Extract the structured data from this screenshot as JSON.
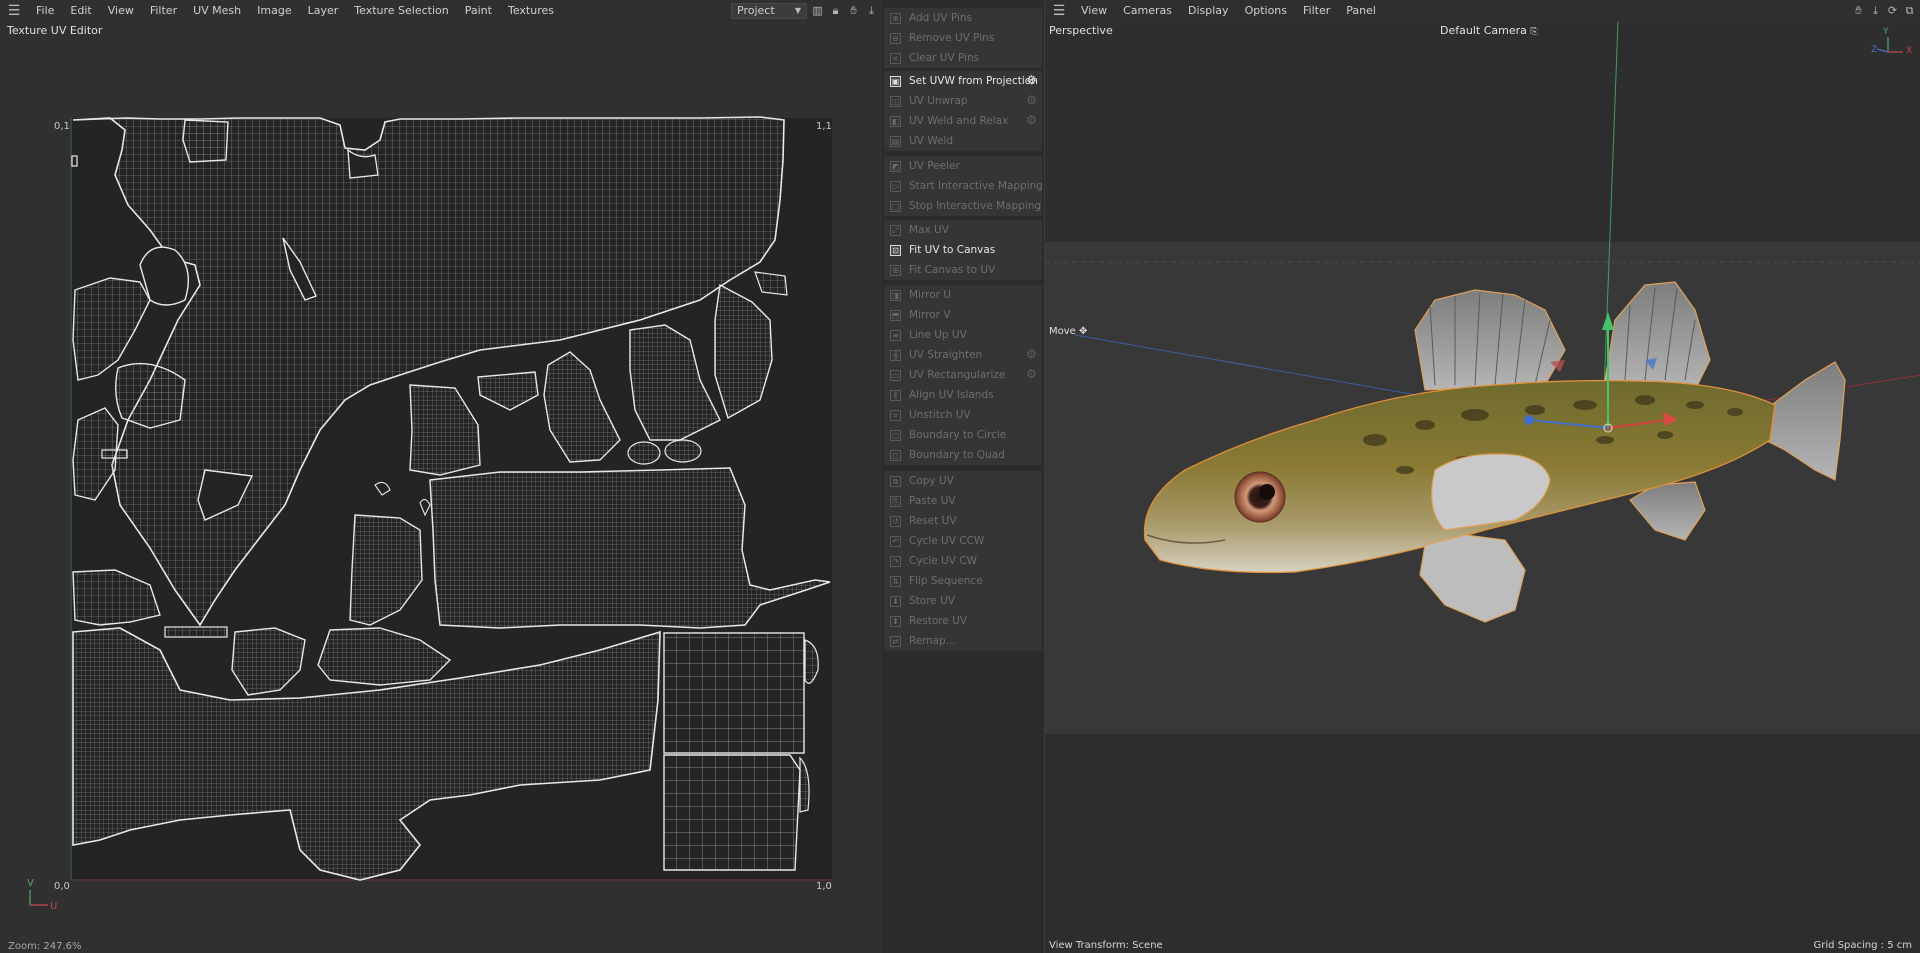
{
  "uv_editor": {
    "menu": [
      "File",
      "Edit",
      "View",
      "Filter",
      "UV Mesh",
      "Image",
      "Layer",
      "Texture Selection",
      "Paint",
      "Textures"
    ],
    "project_select": "Project",
    "title": "Texture UV Editor",
    "corners": {
      "top_left": "0,1",
      "top_right": "1,1",
      "bottom_left": "0,0",
      "bottom_right": "1,0"
    },
    "axes": {
      "v": "V",
      "u": "U"
    },
    "zoom": "Zoom: 247.6%"
  },
  "commands": {
    "group1": [
      {
        "label": "Add UV Pins",
        "enabled": false,
        "gear": false,
        "icon": "pin-icon"
      },
      {
        "label": "Remove UV Pins",
        "enabled": false,
        "gear": false,
        "icon": "pin-remove-icon"
      },
      {
        "label": "Clear UV Pins",
        "enabled": false,
        "gear": false,
        "icon": "clear-icon"
      }
    ],
    "group2": [
      {
        "label": "Set UVW from Projection",
        "enabled": true,
        "gear": true,
        "icon": "projection-icon"
      },
      {
        "label": "UV Unwrap",
        "enabled": false,
        "gear": true,
        "icon": "unwrap-icon"
      },
      {
        "label": "UV Weld and Relax",
        "enabled": false,
        "gear": true,
        "icon": "weld-relax-icon"
      },
      {
        "label": "UV Weld",
        "enabled": false,
        "gear": false,
        "icon": "weld-icon"
      }
    ],
    "group3": [
      {
        "label": "UV Peeler",
        "enabled": false,
        "gear": false,
        "icon": "peeler-icon"
      },
      {
        "label": "Start Interactive Mapping",
        "enabled": false,
        "gear": false,
        "icon": "play-icon"
      },
      {
        "label": "Stop Interactive Mapping",
        "enabled": false,
        "gear": false,
        "icon": "stop-icon"
      }
    ],
    "group4": [
      {
        "label": "Max UV",
        "enabled": false,
        "gear": false,
        "icon": "max-icon"
      },
      {
        "label": "Fit UV to Canvas",
        "enabled": true,
        "gear": false,
        "icon": "fit-canvas-icon"
      },
      {
        "label": "Fit Canvas to UV",
        "enabled": false,
        "gear": false,
        "icon": "fit-uv-icon"
      }
    ],
    "group5": [
      {
        "label": "Mirror U",
        "enabled": false,
        "gear": false,
        "icon": "mirror-u-icon"
      },
      {
        "label": "Mirror V",
        "enabled": false,
        "gear": false,
        "icon": "mirror-v-icon"
      },
      {
        "label": "Line Up UV",
        "enabled": false,
        "gear": false,
        "icon": "line-up-icon"
      },
      {
        "label": "UV Straighten",
        "enabled": false,
        "gear": true,
        "icon": "straighten-icon"
      },
      {
        "label": "UV Rectangularize",
        "enabled": false,
        "gear": true,
        "icon": "rectangularize-icon"
      },
      {
        "label": "Align UV Islands",
        "enabled": false,
        "gear": false,
        "icon": "align-icon"
      },
      {
        "label": "Unstitch UV",
        "enabled": false,
        "gear": false,
        "icon": "unstitch-icon"
      },
      {
        "label": "Boundary to Circle",
        "enabled": false,
        "gear": false,
        "icon": "circle-icon"
      },
      {
        "label": "Boundary to Quad",
        "enabled": false,
        "gear": false,
        "icon": "quad-icon"
      }
    ],
    "group6": [
      {
        "label": "Copy UV",
        "enabled": false,
        "gear": false,
        "icon": "copy-icon"
      },
      {
        "label": "Paste UV",
        "enabled": false,
        "gear": false,
        "icon": "paste-icon"
      },
      {
        "label": "Reset UV",
        "enabled": false,
        "gear": false,
        "icon": "reset-icon"
      },
      {
        "label": "Cycle UV CCW",
        "enabled": false,
        "gear": false,
        "icon": "cycle-ccw-icon"
      },
      {
        "label": "Cycle UV CW",
        "enabled": false,
        "gear": false,
        "icon": "cycle-cw-icon"
      },
      {
        "label": "Flip Sequence",
        "enabled": false,
        "gear": false,
        "icon": "flip-icon"
      },
      {
        "label": "Store UV",
        "enabled": false,
        "gear": false,
        "icon": "store-icon"
      },
      {
        "label": "Restore UV",
        "enabled": false,
        "gear": false,
        "icon": "restore-icon"
      },
      {
        "label": "Remap...",
        "enabled": false,
        "gear": false,
        "icon": "remap-icon"
      }
    ]
  },
  "viewport": {
    "menu": [
      "View",
      "Cameras",
      "Display",
      "Options",
      "Filter",
      "Panel"
    ],
    "perspective": "Perspective",
    "camera": "Default Camera",
    "move_label": "Move",
    "view_transform": "View Transform: Scene",
    "grid_spacing": "Grid Spacing : 5 cm",
    "gizmo_axes": {
      "y": "Y",
      "z": "Z",
      "x": "X"
    }
  }
}
